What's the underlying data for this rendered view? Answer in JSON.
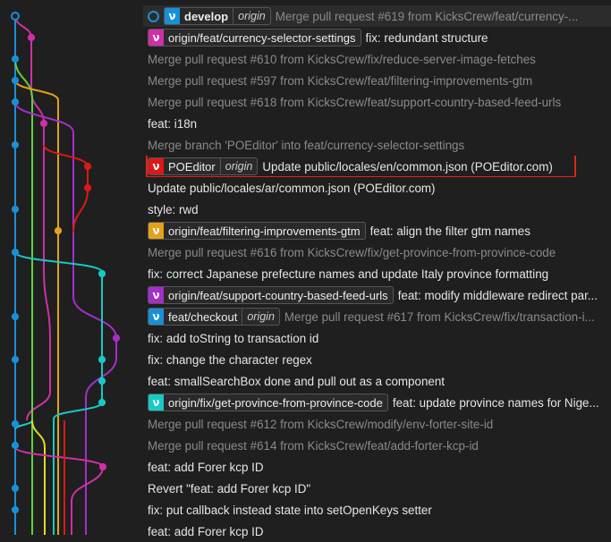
{
  "colors": {
    "background": "#1f1f1f",
    "blue": "#1a8fd8",
    "magenta": "#d02fa6",
    "red": "#dc1818",
    "orange": "#e4a11b",
    "purple": "#a52ec9",
    "cyan": "#18c9c5",
    "green": "#5fd23c",
    "yellow": "#dddd22",
    "highlight": "#e0241c"
  },
  "commits": [
    {
      "refs": [
        {
          "name": "develop",
          "remote": "origin",
          "color": "#1a8fd8",
          "icon": "branch-icon",
          "bold": true
        }
      ],
      "head": true,
      "message": "Merge pull request #619 from KicksCrew/feat/currency-...",
      "dim": true
    },
    {
      "refs": [
        {
          "name": "origin/feat/currency-selector-settings",
          "color": "#d02fa6",
          "icon": "branch-icon"
        }
      ],
      "message": "fix: redundant structure",
      "dim": false
    },
    {
      "refs": [],
      "message": "Merge pull request #610 from KicksCrew/fix/reduce-server-image-fetches",
      "dim": true
    },
    {
      "refs": [],
      "message": "Merge pull request #597 from KicksCrew/feat/filtering-improvements-gtm",
      "dim": true
    },
    {
      "refs": [],
      "message": "Merge pull request #618 from KicksCrew/feat/support-country-based-feed-urls",
      "dim": true
    },
    {
      "refs": [],
      "message": "feat: i18n",
      "dim": false
    },
    {
      "refs": [],
      "message": "Merge branch 'POEditor' into feat/currency-selector-settings",
      "dim": true
    },
    {
      "refs": [
        {
          "name": "POEditor",
          "remote": "origin",
          "color": "#dc1818",
          "icon": "branch-icon"
        }
      ],
      "message": "Update public/locales/en/common.json (POEditor.com)",
      "dim": false,
      "highlight": true
    },
    {
      "refs": [],
      "message": "Update public/locales/ar/common.json (POEditor.com)",
      "dim": false
    },
    {
      "refs": [],
      "message": "style: rwd",
      "dim": false
    },
    {
      "refs": [
        {
          "name": "origin/feat/filtering-improvements-gtm",
          "color": "#e4a11b",
          "icon": "branch-icon"
        }
      ],
      "message": "feat: align the filter gtm names",
      "dim": false
    },
    {
      "refs": [],
      "message": "Merge pull request #616 from KicksCrew/fix/get-province-from-province-code",
      "dim": true
    },
    {
      "refs": [],
      "message": "fix: correct Japanese prefecture names and update Italy province formatting",
      "dim": false
    },
    {
      "refs": [
        {
          "name": "origin/feat/support-country-based-feed-urls",
          "color": "#a52ec9",
          "icon": "branch-icon"
        }
      ],
      "message": "feat: modify middleware redirect par...",
      "dim": false
    },
    {
      "refs": [
        {
          "name": "feat/checkout",
          "remote": "origin",
          "color": "#1a8fd8",
          "icon": "branch-icon"
        }
      ],
      "message": "Merge pull request #617 from KicksCrew/fix/transaction-i...",
      "dim": true
    },
    {
      "refs": [],
      "message": "fix: add toString to transaction id",
      "dim": false
    },
    {
      "refs": [],
      "message": "fix: change the character regex",
      "dim": false
    },
    {
      "refs": [],
      "message": "feat: smallSearchBox done and pull out as a component",
      "dim": false
    },
    {
      "refs": [
        {
          "name": "origin/fix/get-province-from-province-code",
          "color": "#18c9c5",
          "icon": "branch-icon"
        }
      ],
      "message": "feat: update province names for Nige...",
      "dim": false
    },
    {
      "refs": [],
      "message": "Merge pull request #612 from KicksCrew/modify/env-forter-site-id",
      "dim": true
    },
    {
      "refs": [],
      "message": "Merge pull request #614 from KicksCrew/feat/add-forter-kcp-id",
      "dim": true
    },
    {
      "refs": [],
      "message": "feat: add Forer kcp ID",
      "dim": false
    },
    {
      "refs": [],
      "message": "Revert \"feat: add Forer kcp ID\"",
      "dim": false
    },
    {
      "refs": [],
      "message": "fix: put callback instead state into setOpenKeys setter",
      "dim": false
    },
    {
      "refs": [],
      "message": "feat: add Forer kcp ID",
      "dim": false
    }
  ]
}
